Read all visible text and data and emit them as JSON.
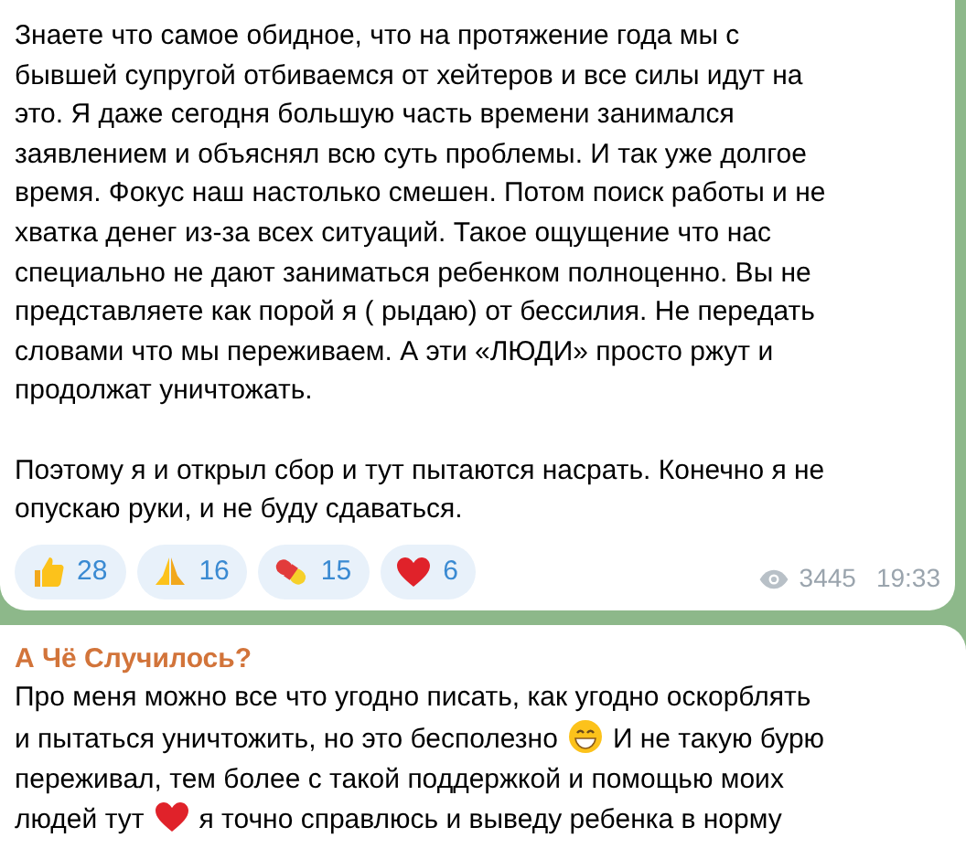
{
  "messages": [
    {
      "paragraphs": [
        [
          {
            "kind": "text",
            "text": "Знаете что самое обидное, что на протяжение года мы с\nбывшей супругой отбиваемся от хейтеров и все силы идут на\nэто. Я даже сегодня большую часть времени занимался\nзаявлением и объяснял всю суть проблемы. И так уже долгое\nвремя. Фокус наш настолько смешен. Потом поиск работы и не\nхватка денег из-за всех ситуаций. Такое ощущение что нас\nспециально не дают заниматься ребенком полноценно. Вы не\nпредставляете как порой я ( рыдаю) от бессилия. Не передать\nсловами что мы переживаем. А эти «ЛЮДИ» просто ржут и\nпродолжат уничтожать."
          }
        ],
        [
          {
            "kind": "text",
            "text": "Поэтому я и открыл сбор и тут пытаются насрать.  Конечно я не\nопускаю руки, и не буду сдаваться."
          }
        ]
      ],
      "reactions": [
        {
          "kind": "thumbs",
          "count": "28"
        },
        {
          "kind": "pray",
          "count": "16"
        },
        {
          "kind": "pill",
          "count": "15"
        },
        {
          "kind": "heart",
          "count": "6"
        }
      ],
      "views": "3445",
      "time": "19:33"
    },
    {
      "sender": "А Чё Случилось?",
      "paragraphs": [
        [
          {
            "kind": "text",
            "text": "Про меня можно все что угодно писать, как угодно оскорблять\nи пытаться уничтожить, но это бесполезно"
          },
          {
            "kind": "grin"
          },
          {
            "kind": "text",
            "text": "И не такую бурю\nпереживал, тем более с такой поддержкой и помощью моих\nлюдей тут"
          },
          {
            "kind": "heart"
          },
          {
            "kind": "text",
            "text": "я точно справлюсь и выведу ребенка в норму"
          }
        ]
      ]
    }
  ]
}
